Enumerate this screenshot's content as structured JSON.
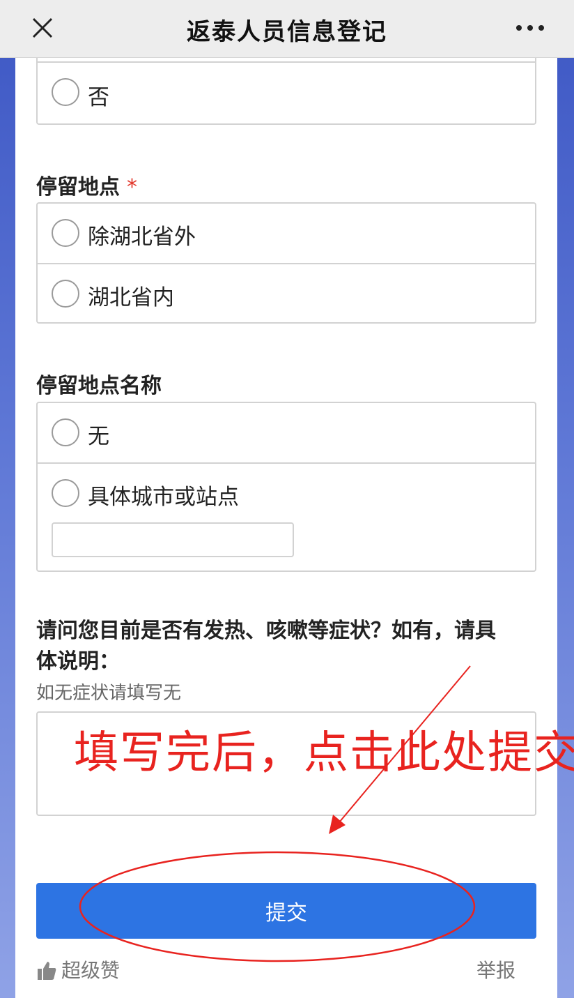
{
  "header": {
    "title": "返泰人员信息登记"
  },
  "q_prev": {
    "option_no": "否"
  },
  "q_location": {
    "label": "停留地点",
    "required_mark": "*",
    "options": [
      "除湖北省外",
      "湖北省内"
    ]
  },
  "q_location_name": {
    "label": "停留地点名称",
    "options": [
      "无",
      "具体城市或站点"
    ],
    "input_value": ""
  },
  "q_symptoms": {
    "label_line1": "请问您目前是否有发热、咳嗽等症状？如有，请具",
    "label_line2": "体说明：",
    "hint": "如无症状请填写无",
    "value": ""
  },
  "submit_label": "提交",
  "footer": {
    "like_label": "超级赞",
    "report_label": "举报"
  },
  "annotation": {
    "text": "填写完后，点击此处提交",
    "color": "#e8231f"
  },
  "colors": {
    "accent": "#2d74e3",
    "required": "#e2372b"
  }
}
